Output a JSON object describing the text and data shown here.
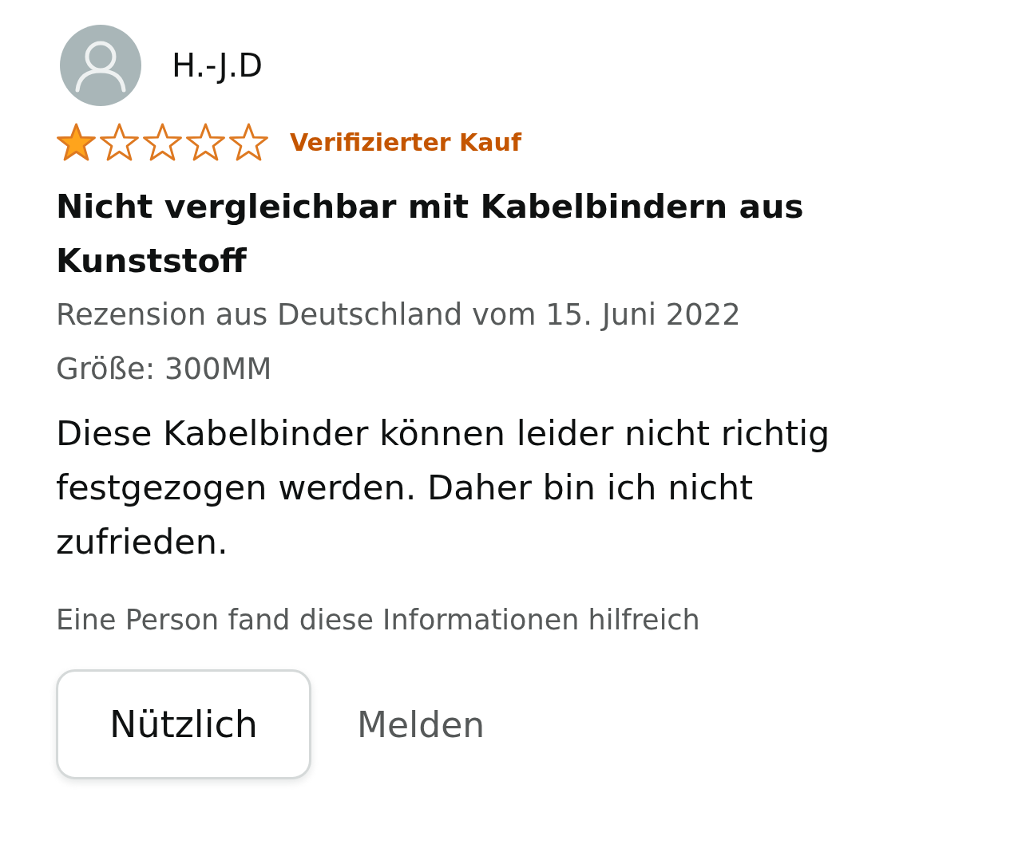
{
  "review": {
    "author": "H.-J.D",
    "stars": 1,
    "badge": "Verifizierter Kauf",
    "title": "Nicht vergleichbar mit Kabelbindern aus Kunststoff",
    "meta": "Rezension aus Deutschland vom 15. Juni 2022",
    "variant": "Größe: 300MM",
    "body": "Diese Kabelbinder können leider nicht richtig festgezogen werden. Daher bin ich nicht zufrieden.",
    "helpful": "Eine Person fand diese Informationen hilfreich"
  },
  "actions": [
    {
      "kind": "button",
      "label": "Nützlich"
    },
    {
      "kind": "link",
      "label": "Melden"
    }
  ]
}
